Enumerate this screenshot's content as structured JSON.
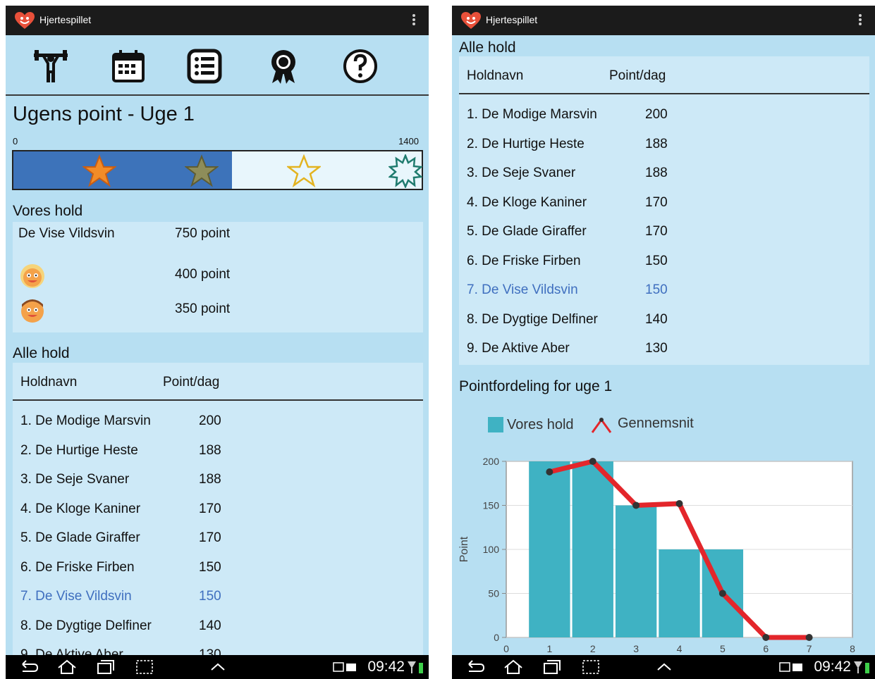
{
  "app": {
    "title": "Hjertespillet",
    "brand_color": "#e8503a",
    "accent_color": "#3d73ba",
    "background_color": "#b7dff2"
  },
  "status_bar": {
    "time": "09:42"
  },
  "nav_icons": [
    "weightlifter-icon",
    "calendar-icon",
    "list-icon",
    "award-ribbon-icon",
    "help-icon"
  ],
  "left": {
    "weekly_title": "Ugens point - Uge 1",
    "progress": {
      "min_label": "0",
      "max_label": "1400",
      "value": 750,
      "max": 1400
    },
    "our_team": {
      "label": "Vores hold",
      "team_name": "De Vise Vildsvin",
      "team_points": "750 point",
      "members": [
        {
          "avatar": "girl-avatar-icon",
          "points": "400 point"
        },
        {
          "avatar": "boy-avatar-icon",
          "points": "350 point"
        }
      ]
    }
  },
  "all_teams": {
    "label": "Alle hold",
    "col_name": "Holdnavn",
    "col_points": "Point/dag",
    "rows": [
      {
        "name": "1. De Modige Marsvin",
        "points": "200"
      },
      {
        "name": "2. De Hurtige Heste",
        "points": "188"
      },
      {
        "name": "3. De Seje Svaner",
        "points": "188"
      },
      {
        "name": "4. De Kloge Kaniner",
        "points": "170"
      },
      {
        "name": "5. De Glade Giraffer",
        "points": "170"
      },
      {
        "name": "6. De Friske Firben",
        "points": "150"
      },
      {
        "name": "7. De Vise Vildsvin",
        "points": "150",
        "highlight": true
      },
      {
        "name": "8. De Dygtige Delfiner",
        "points": "140"
      },
      {
        "name": "9. De Aktive Aber",
        "points": "130"
      }
    ]
  },
  "chart_section_title": "Pointfordeling for uge 1",
  "chart_data": {
    "type": "bar",
    "ylabel": "Point",
    "xlim": [
      0,
      8
    ],
    "ylim": [
      0,
      200
    ],
    "x_ticks": [
      "0",
      "1",
      "2",
      "3",
      "4",
      "5",
      "6",
      "7",
      "8"
    ],
    "y_ticks": [
      "0",
      "50",
      "100",
      "150",
      "200"
    ],
    "series": [
      {
        "name": "Vores hold",
        "kind": "bar",
        "color": "#3fb2c3",
        "x": [
          1,
          2,
          3,
          4,
          5
        ],
        "values": [
          200,
          200,
          150,
          100,
          100
        ]
      },
      {
        "name": "Gennemsnit",
        "kind": "line",
        "color": "#e3262b",
        "x": [
          1,
          2,
          3,
          4,
          5,
          6,
          7
        ],
        "values": [
          188,
          200,
          150,
          152,
          50,
          0,
          0
        ]
      }
    ],
    "legend": "top-left",
    "grid": true
  }
}
